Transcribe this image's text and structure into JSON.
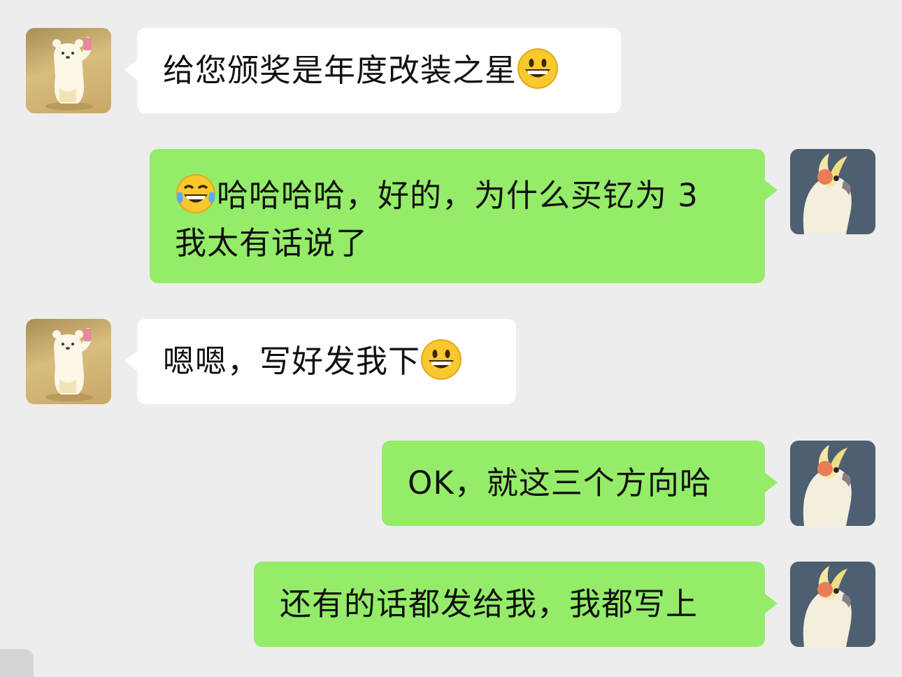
{
  "chat": {
    "messages": [
      {
        "side": "left",
        "avatar": "bear-avatar",
        "text": "给您颁奖是年度改装之星",
        "emoji": "grinning-face-emoji"
      },
      {
        "side": "right",
        "avatar": "cockatiel-avatar",
        "emoji": "tears-of-joy-emoji",
        "line1": "哈哈哈哈，好的，为什么买钇为 3",
        "line2": "我太有话说了"
      },
      {
        "side": "left",
        "avatar": "bear-avatar",
        "text": "嗯嗯，写好发我下",
        "emoji": "grinning-face-emoji"
      },
      {
        "side": "right",
        "avatar": "cockatiel-avatar",
        "text": "OK，就这三个方向哈"
      },
      {
        "side": "right",
        "avatar": "cockatiel-avatar",
        "text": "还有的话都发给我，我都写上"
      }
    ]
  },
  "colors": {
    "background": "#ededed",
    "incoming_bubble": "#ffffff",
    "outgoing_bubble": "#95ec69"
  }
}
